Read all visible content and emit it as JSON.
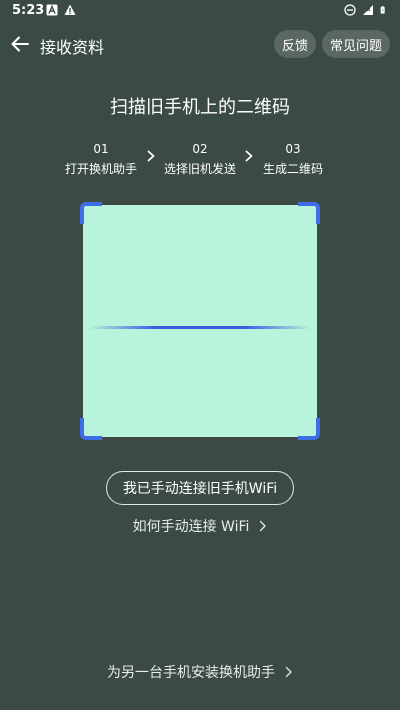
{
  "status_bar": {
    "time": "5:23",
    "left_icons": [
      "a-notification-icon",
      "warning-icon"
    ],
    "right_icons": [
      "do-not-disturb-icon",
      "signal-icon",
      "battery-icon"
    ]
  },
  "header": {
    "title": "接收资料",
    "feedback_label": "反馈",
    "faq_label": "常见问题"
  },
  "main": {
    "title": "扫描旧手机上的二维码",
    "steps": [
      {
        "num": "01",
        "label": "打开换机助手"
      },
      {
        "num": "02",
        "label": "选择旧机发送"
      },
      {
        "num": "03",
        "label": "生成二维码"
      }
    ]
  },
  "actions": {
    "connect_label": "我已手动连接旧手机WiFi",
    "howto_label": "如何手动连接 WiFi",
    "install_label": "为另一台手机安装换机助手"
  },
  "colors": {
    "background": "#3b4a42",
    "scan_area": "#b8f3dc",
    "accent": "#3f6de6",
    "pill_bg": "#5b6861"
  }
}
